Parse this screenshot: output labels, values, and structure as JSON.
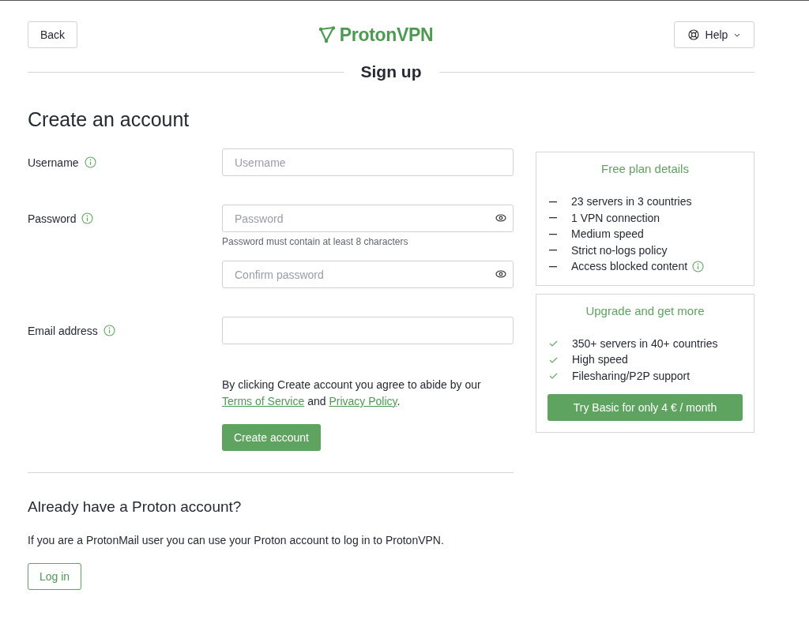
{
  "header": {
    "back_button": "Back",
    "logo": "ProtonVPN",
    "help_button": "Help"
  },
  "heading": "Sign up",
  "title": "Create an account",
  "fields": [
    {
      "label": "Username",
      "info": true,
      "inputs": [
        {
          "kind": "text",
          "placeholder": "Username"
        }
      ]
    },
    {
      "label": "Password",
      "info": true,
      "inputs": [
        {
          "kind": "password",
          "placeholder": "Password",
          "hint": "Password must contain at least 8 characters"
        },
        {
          "kind": "password",
          "placeholder": "Confirm password"
        }
      ]
    },
    {
      "label": "Email address",
      "info": true,
      "inputs": [
        {
          "kind": "text"
        }
      ]
    }
  ],
  "terms": {
    "before": "By clicking Create account you agree to abide by our",
    "link_1": "Terms of Service",
    "middle": "and",
    "link_2": "Privacy Policy",
    "end": "."
  },
  "create_button": "Create account",
  "login": {
    "heading": "Already have a Proton account?",
    "text": "If you are a ProtonMail user you can use your Proton account to log in to ProtonVPN.",
    "button": "Log in"
  },
  "plans": [
    {
      "title": "Free plan details",
      "features": [
        {
          "kind": "dash",
          "text": "23 servers in 3 countries"
        },
        {
          "kind": "dash",
          "text": "1 VPN connection"
        },
        {
          "kind": "dash",
          "text": "Medium speed"
        },
        {
          "kind": "dash",
          "text": "Strict no-logs policy"
        },
        {
          "kind": "dash",
          "text": "Access blocked content",
          "info": true
        }
      ]
    },
    {
      "title": "Upgrade and get more",
      "features": [
        {
          "kind": "check",
          "text": "350+ servers in 40+ countries"
        },
        {
          "kind": "check",
          "text": "High speed"
        },
        {
          "kind": "check",
          "text": "Filesharing/P2P support"
        }
      ],
      "button": "Try Basic for only 4 € / month"
    }
  ]
}
